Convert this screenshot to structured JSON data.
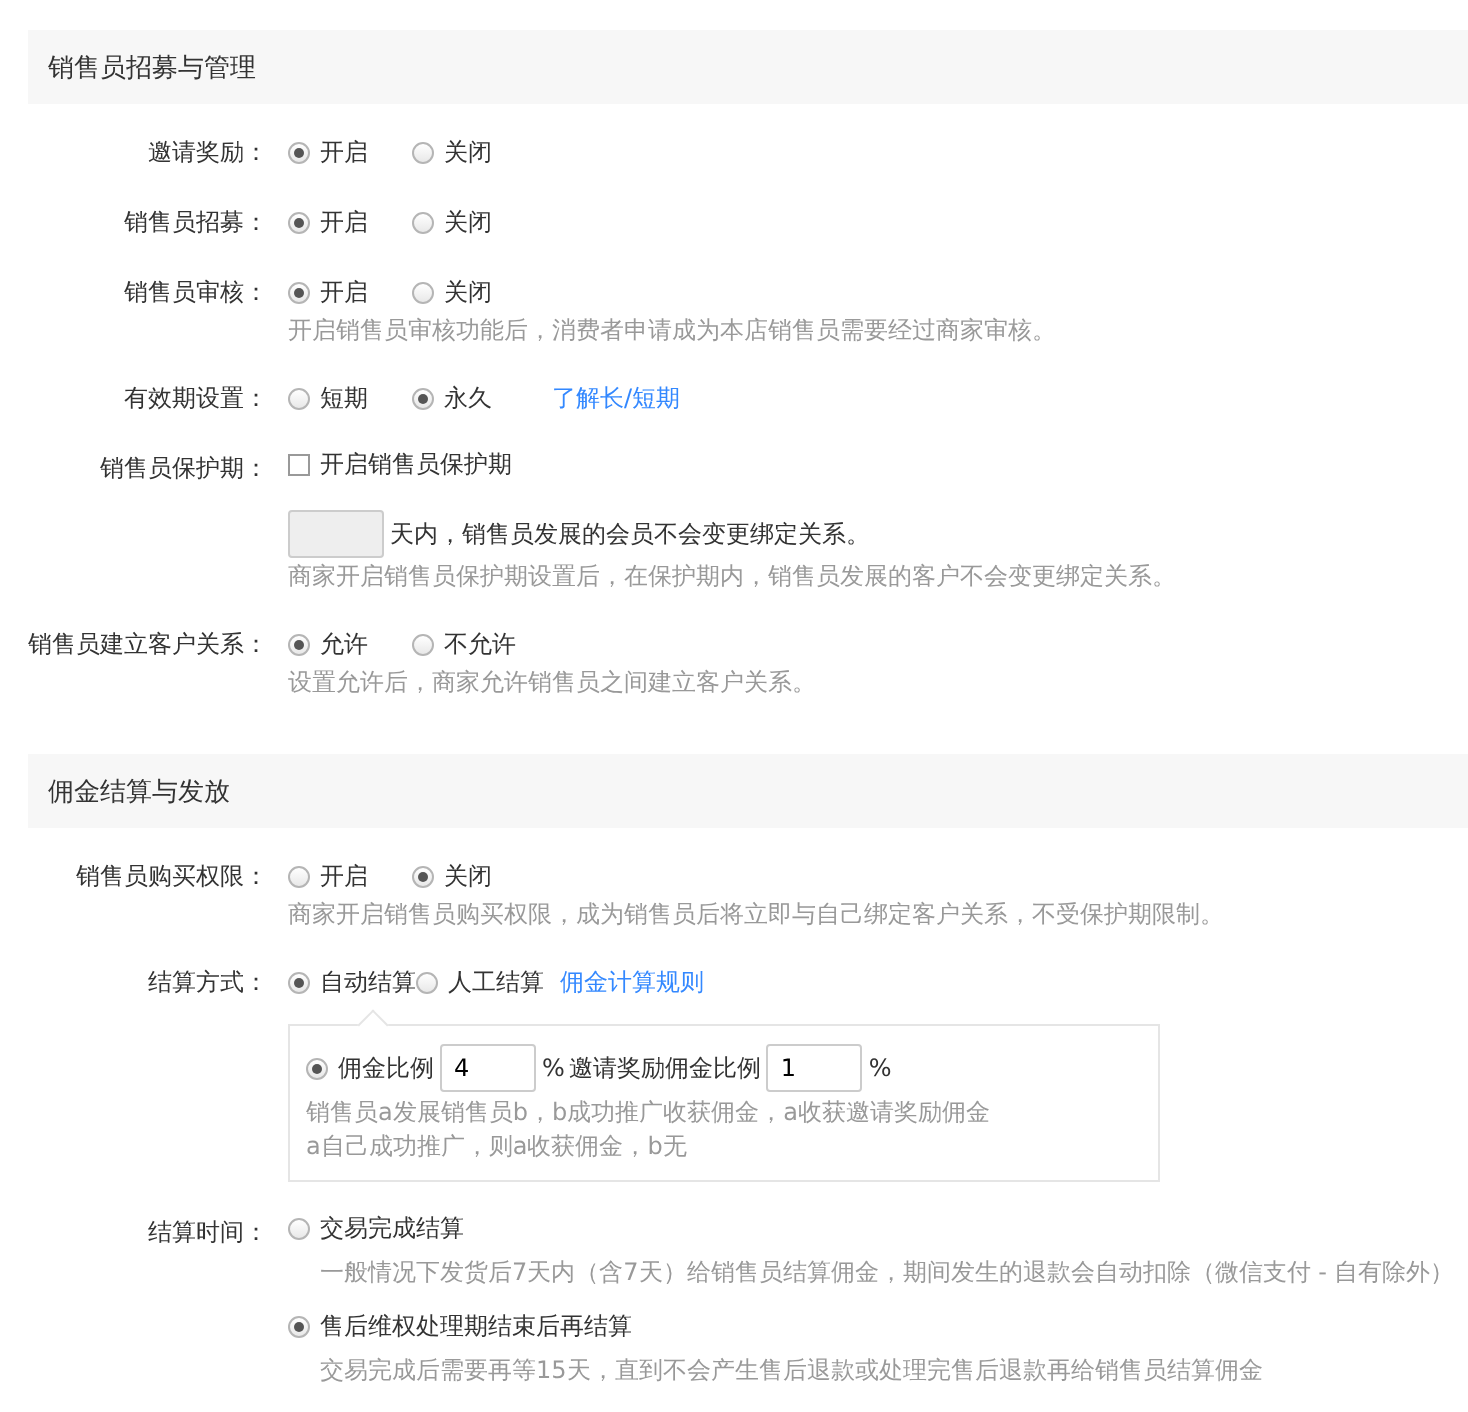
{
  "sections": [
    {
      "title": "销售员招募与管理",
      "rows": [
        {
          "kind": "radio",
          "label": "邀请奖励：",
          "options": [
            {
              "label": "开启",
              "selected": true
            },
            {
              "label": "关闭",
              "selected": false
            }
          ]
        },
        {
          "kind": "radio",
          "label": "销售员招募：",
          "options": [
            {
              "label": "开启",
              "selected": true
            },
            {
              "label": "关闭",
              "selected": false
            }
          ]
        },
        {
          "kind": "radio",
          "label": "销售员审核：",
          "options": [
            {
              "label": "开启",
              "selected": true
            },
            {
              "label": "关闭",
              "selected": false
            }
          ],
          "hint": "开启销售员审核功能后，消费者申请成为本店销售员需要经过商家审核。"
        },
        {
          "kind": "radio",
          "label": "有效期设置：",
          "options": [
            {
              "label": "短期",
              "selected": false
            },
            {
              "label": "永久",
              "selected": true
            }
          ],
          "link": "了解长/短期"
        },
        {
          "kind": "checkbox",
          "label": "销售员保护期：",
          "option": {
            "label": "开启销售员保护期",
            "checked": false
          }
        },
        {
          "kind": "days",
          "disabled": true,
          "text": "天内，销售员发展的会员不会变更绑定关系。",
          "hint": "商家开启销售员保护期设置后，在保护期内，销售员发展的客户不会变更绑定关系。"
        },
        {
          "kind": "radio",
          "label": "销售员建立客户关系：",
          "options": [
            {
              "label": "允许",
              "selected": true
            },
            {
              "label": "不允许",
              "selected": false
            }
          ],
          "hint": "设置允许后，商家允许销售员之间建立客户关系。"
        }
      ]
    },
    {
      "title": "佣金结算与发放",
      "rows": [
        {
          "kind": "radio",
          "label": "销售员购买权限：",
          "options": [
            {
              "label": "开启",
              "selected": false
            },
            {
              "label": "关闭",
              "selected": true
            }
          ],
          "hint": "商家开启销售员购买权限，成为销售员后将立即与自己绑定客户关系，不受保护期限制。"
        },
        {
          "kind": "radio",
          "label": "结算方式：",
          "options": [
            {
              "label": "自动结算",
              "selected": true
            },
            {
              "label": "人工结算",
              "selected": false
            }
          ],
          "link": "佣金计算规则"
        },
        {
          "kind": "ratio_box",
          "option": {
            "label": "佣金比例",
            "selected": true
          },
          "value": "4",
          "unit": "%",
          "invite_label": "邀请奖励佣金比例",
          "invite_value": "1",
          "invite_unit": "%",
          "hints": [
            "销售员a发展销售员b，b成功推广收获佣金，a收获邀请奖励佣金",
            "a自己成功推广，则a收获佣金，b无"
          ]
        },
        {
          "kind": "radio_stack",
          "label": "结算时间：",
          "options": [
            {
              "label": "交易完成结算",
              "selected": false,
              "hint": "一般情况下发货后7天内（含7天）给销售员结算佣金，期间发生的退款会自动扣除（微信支付 - 自有除外）"
            },
            {
              "label": "售后维权处理期结束后再结算",
              "selected": true,
              "hint": "交易完成后需要再等15天，直到不会产生售后退款或处理完售后退款再给销售员结算佣金"
            }
          ]
        }
      ]
    }
  ]
}
